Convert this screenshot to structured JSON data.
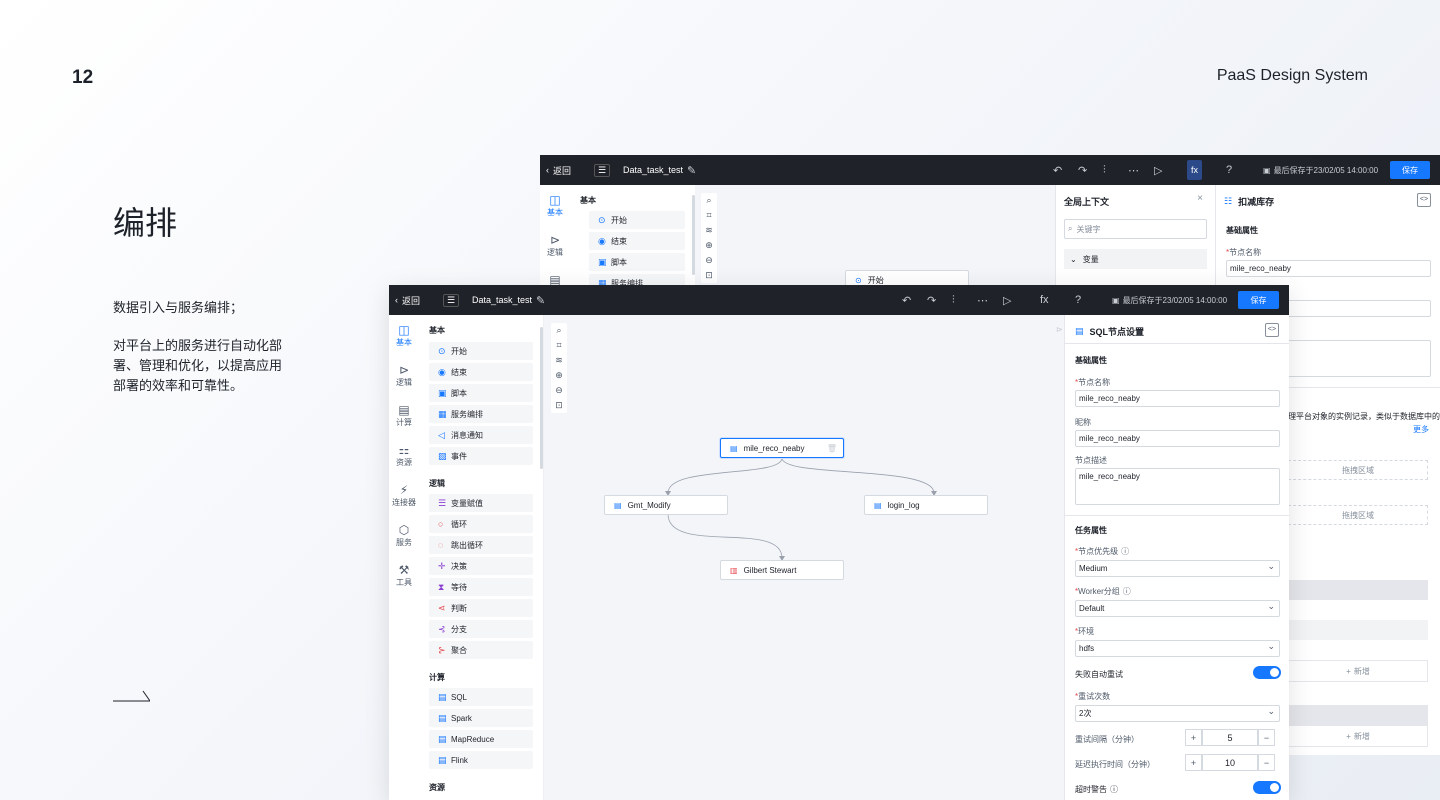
{
  "slide": {
    "page_number": "12",
    "brand": "PaaS Design System",
    "title": "编排",
    "subtitle": "数据引入与服务编排；",
    "description": "对平台上的服务进行自动化部署、管理和优化，以提高应用部署的效率和可靠性。"
  },
  "back_app": {
    "back_label": "返回",
    "file_name": "Data_task_test",
    "fx_label": "fx",
    "last_saved": "最后保存于23/02/05 14:00:00",
    "save_label": "保存",
    "rail": [
      {
        "label": "基本",
        "icon": "layout-icon"
      },
      {
        "label": "逻辑",
        "icon": "logic-icon"
      }
    ],
    "palette_heading": "基本",
    "palette_items": [
      {
        "label": "开始",
        "icon": "play-icon"
      },
      {
        "label": "结束",
        "icon": "stop-icon"
      },
      {
        "label": "脚本",
        "icon": "script-icon"
      },
      {
        "label": "服务编排",
        "icon": "orchestration-icon"
      }
    ],
    "canvas_node": "开始",
    "context_panel": {
      "title": "全局上下文",
      "search_placeholder": "关键字",
      "group_label": "变量"
    },
    "right_panel": {
      "title": "扣减库存",
      "section": "基础属性",
      "node_name_label": "节点名称",
      "node_name_value": "mile_reco_neaby",
      "help_text": "理平台对象的实例记录，类似于数据库中的",
      "more_link": "更多",
      "drop_zone_1": "拖拽区域",
      "drop_zone_2": "拖拽区域",
      "add_label_1": "新增",
      "add_label_2": "新增"
    }
  },
  "front_app": {
    "back_label": "返回",
    "file_name": "Data_task_test",
    "fx_label": "fx",
    "last_saved": "最后保存于23/02/05 14:00:00",
    "save_label": "保存",
    "rail": [
      {
        "label": "基本",
        "icon": "layout-icon",
        "active": true
      },
      {
        "label": "逻辑",
        "icon": "logic-icon"
      },
      {
        "label": "计算",
        "icon": "compute-icon"
      },
      {
        "label": "资源",
        "icon": "resource-icon"
      },
      {
        "label": "连接器",
        "icon": "connector-icon"
      },
      {
        "label": "服务",
        "icon": "service-icon"
      },
      {
        "label": "工具",
        "icon": "tool-icon"
      }
    ],
    "palette": {
      "basic_heading": "基本",
      "basic_items": [
        {
          "label": "开始",
          "icon": "play-icon"
        },
        {
          "label": "结束",
          "icon": "stop-icon"
        },
        {
          "label": "脚本",
          "icon": "script-icon"
        },
        {
          "label": "服务编排",
          "icon": "orchestration-icon"
        },
        {
          "label": "消息通知",
          "icon": "megaphone-icon"
        },
        {
          "label": "事件",
          "icon": "event-icon"
        }
      ],
      "logic_heading": "逻辑",
      "logic_items": [
        {
          "label": "变量赋值",
          "icon": "assign-icon"
        },
        {
          "label": "循环",
          "icon": "loop-icon"
        },
        {
          "label": "跳出循环",
          "icon": "break-loop-icon"
        },
        {
          "label": "决策",
          "icon": "decision-icon"
        },
        {
          "label": "等待",
          "icon": "hourglass-icon"
        },
        {
          "label": "判断",
          "icon": "judge-icon"
        },
        {
          "label": "分支",
          "icon": "branch-icon"
        },
        {
          "label": "聚合",
          "icon": "merge-icon"
        }
      ],
      "compute_heading": "计算",
      "compute_items": [
        {
          "label": "SQL",
          "icon": "sql-icon"
        },
        {
          "label": "Spark",
          "icon": "spark-icon"
        },
        {
          "label": "MapReduce",
          "icon": "mapreduce-icon"
        },
        {
          "label": "Flink",
          "icon": "flink-icon"
        }
      ],
      "resource_heading": "资源"
    },
    "nodes": {
      "root": "mile_reco_neaby",
      "left": "Gmt_Modify",
      "right": "login_log",
      "bottom": "Gilbert Stewart"
    },
    "sql_panel": {
      "title": "SQL节点设置",
      "basic_section": "基础属性",
      "node_name_label": "节点名称",
      "node_name_value": "mile_reco_neaby",
      "alias_label": "昵称",
      "alias_value": "mile_reco_neaby",
      "desc_label": "节点描述",
      "desc_value": "mile_reco_neaby",
      "task_section": "任务属性",
      "priority_label": "节点优先级",
      "priority_value": "Medium",
      "worker_label": "Worker分组",
      "worker_value": "Default",
      "env_label": "环境",
      "env_value": "hdfs",
      "auto_retry_label": "失败自动重试",
      "auto_retry_on": true,
      "retry_count_label": "重试次数",
      "retry_count_value": "2次",
      "retry_interval_label": "重试间隔（分钟）",
      "retry_interval_value": "5",
      "delay_label": "延迟执行时间（分钟）",
      "delay_value": "10",
      "timeout_label": "超时警告",
      "timeout_on": true
    }
  },
  "colors": {
    "accent": "#1677ff",
    "topbar": "#1f2229",
    "canvas": "#f3f5f9"
  }
}
